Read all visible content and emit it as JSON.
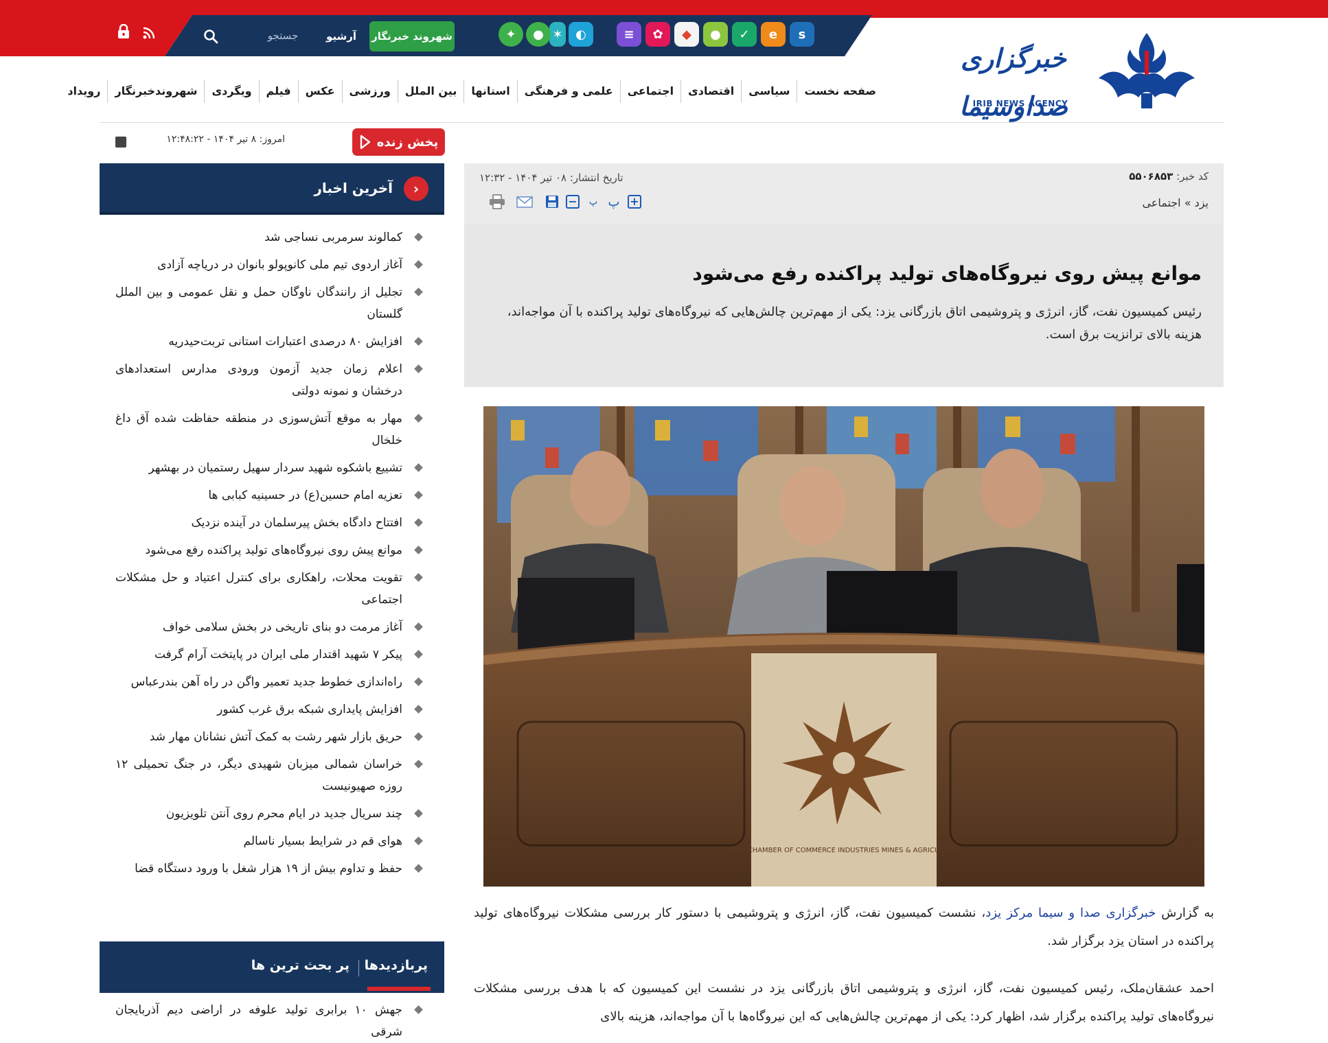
{
  "topbar": {
    "citizen_reporter": "شهروند خبرنگار",
    "archive": "آرشیو",
    "search_placeholder": "جستجو",
    "app_icons": [
      "sorush-icon",
      "eitaa-icon",
      "bale-icon",
      "gap-icon",
      "rubika-icon",
      "aparat-icon",
      "telewebion-icon",
      "igap-icon",
      "shad-icon",
      "apple-icon",
      "android-icon"
    ]
  },
  "brand": {
    "name": "خبرگزاری صداوسیما",
    "subtitle": "IRIB NEWS AGENCY"
  },
  "nav": {
    "items": [
      "صفحه نخست",
      "سیاسی",
      "اقتصادی",
      "اجتماعی",
      "علمی و فرهنگی",
      "استانها",
      "بین الملل",
      "ورزشی",
      "عکس",
      "فیلم",
      "ویگردی",
      "شهروندخبرنگار",
      "رویداد"
    ]
  },
  "sidebar": {
    "live": "پخش زنده",
    "today": "امروز: ۸ تیر ۱۴۰۴ - ۱۲:۴۸:۲۲",
    "latest_title": "آخرین اخبار",
    "latest": [
      "کمالوند سرمربی نساجی شد",
      "آغاز اردوی تیم ملی کانوپولو بانوان در دریاچه آزادی",
      "تجلیل از رانندگان ناوگان حمل و نقل عمومی و بین الملل گلستان",
      "افزایش ۸۰ درصدی اعتبارات استانی تربت‌حیدریه",
      "اعلام زمان جدید آزمون ورودی مدارس استعدادهای درخشان و نمونه دولتی",
      "مهار به موقع آتش‌سوزی در منطقه حفاظت شده آق داغ خلخال",
      "تشییع باشکوه شهید سردار سهیل رستمیان در بهشهر",
      "تعزیه امام حسین(ع) در حسینیه کبابی ها",
      "افتتاح دادگاه بخش پیرسلمان در آینده نزدیک",
      "موانع پیش روی نیروگاه‌های تولید پراکنده رفع می‌شود",
      "تقویت محلات، راهکاری برای کنترل اعتیاد و حل مشکلات اجتماعی",
      "آغاز مرمت دو بنای تاریخی در بخش سلامی خواف",
      "پیکر ۷ شهید اقتدار ملی ایران در پایتخت آرام گرفت",
      "راه‌اندازی خطوط جدید تعمیر واگن در راه آهن بندرعباس",
      "افزایش پایداری شبکه برق غرب کشور",
      "حریق بازار شهر رشت به کمک آتش نشانان مهار شد",
      "خراسان شمالی میزبان شهیدی دیگر، در جنگ تحمیلی ۱۲ روزه صهیونیست",
      "چند سریال جدید در ایام محرم روی آنتن تلویزیون",
      "هوای قم در شرایط بسیار ناسالم",
      "حفظ و تداوم بیش از ۱۹ هزار شغل با ورود دستگاه قضا"
    ],
    "popular_tab1": "پربازدیدها",
    "popular_tab2": "پر بحث ترین ها",
    "popular_first": "جهش ۱۰ برابری تولید علوفه در اراضی دیم آذربایجان شرقی"
  },
  "article": {
    "code_label": "کد خبر:",
    "code_value": "۵۵۰۶۸۵۳",
    "pub_date": "تاریخ انتشار: ۰۸ تیر ۱۴۰۴ - ۱۲:۳۲",
    "breadcrumb": "یزد » اجتماعی",
    "tools": {
      "font_smaller": "پ",
      "font_larger": "پ"
    },
    "headline": "موانع پیش روی نیروگاه‌های تولید پراکنده رفع می‌شود",
    "lead": "رئیس کمیسیون نفت، گاز، انرژی و پتروشیمی اتاق بازرگانی یزد: یکی از مهم‌ترین چالش‌هایی که نیروگاه‌های تولید پراکنده با آن مواجه‌اند، هزینه بالای ترانزیت برق است.",
    "photo_emblem_text": "YAZD CHAMBER OF COMMERCE INDUSTRIES MINES & AGRICULTURE",
    "p1_prefix": "به گزارش",
    "p1_link": "خبرگزاری صدا و سیما مرکز یزد",
    "p1_rest": "، نشست کمیسیون نفت، گاز، انرژی و پتروشیمی با دستور کار بررسی مشکلات نیروگاه‌های تولید پراکنده در استان یزد برگزار شد.",
    "p2": "احمد عشقان‌ملک، رئیس کمیسیون نفت، گاز، انرژی و پتروشیمی اتاق بازرگانی یزد در نشست این کمیسیون که با هدف بررسی مشکلات نیروگاه‌های تولید پراکنده برگزار شد، اظهار کرد: یکی از مهم‌ترین چالش‌هایی که این نیروگاه‌ها با آن مواجه‌اند، هزینه بالای"
  },
  "colors": {
    "top_red": "#d8151b",
    "top_navy": "#17345c",
    "accent_red": "#d8282d",
    "green": "#2e9f46",
    "brand_blue": "#13449a",
    "meta_gray": "#ebebeb"
  }
}
